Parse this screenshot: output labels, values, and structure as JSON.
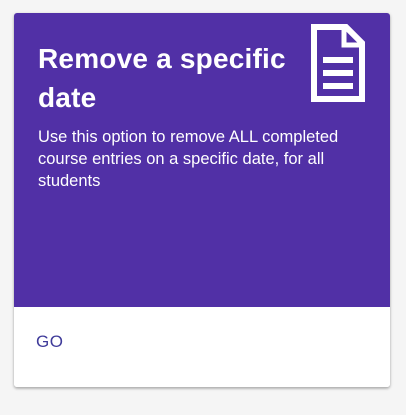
{
  "card": {
    "title": "Remove a specific date",
    "description": "Use this option to remove ALL completed course entries on a specific date, for all students",
    "icon": "document-icon",
    "action_label": "GO",
    "colors": {
      "header_bg": "#5130a6",
      "action_text": "#3f3b9a",
      "text": "#ffffff"
    }
  }
}
